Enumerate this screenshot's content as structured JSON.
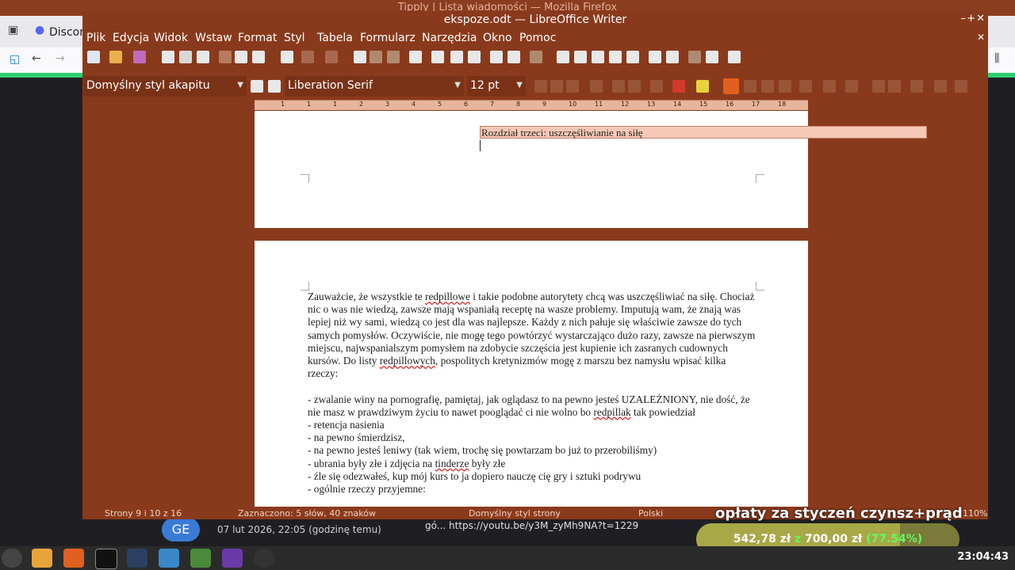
{
  "firefox": {
    "title": "Tipply | Lista wiadomości — Mozilla Firefox",
    "tab_label": "Discor",
    "tab_icon": "discord-icon"
  },
  "writer": {
    "title": "ekspoze.odt — LibreOffice Writer",
    "menu": [
      "Plik",
      "Edycja",
      "Widok",
      "Wstaw",
      "Format",
      "Styl",
      "Tabela",
      "Formularz",
      "Narzędzia",
      "Okno",
      "Pomoc"
    ],
    "paragraph_style": "Domyślny styl akapitu",
    "font_name": "Liberation Serif",
    "font_size": "12 pt",
    "ruler_labels": [
      "1",
      "1",
      "2",
      "3",
      "4",
      "5",
      "6",
      "7",
      "8",
      "9",
      "10",
      "11",
      "12",
      "13",
      "14",
      "15",
      "16",
      "17",
      "18"
    ],
    "heading": "Rozdział trzeci: uszczęśliwianie na siłę",
    "paragraphs": [
      [
        {
          "t": "Zauważcie, że wszystkie te "
        },
        {
          "t": "redpillowe",
          "s": 1
        },
        {
          "t": " i takie podobne autorytety chcą was uszczęśliwiać na siłę. Chociaż nic o was nie wiedzą, zawsze mają wspaniałą receptę na wasze problemy. Imputują wam, że znają was lepiej niż wy sami, wiedzą co jest dla was najlepsze. Każdy z nich pałuje się właściwie zawsze do tych samych pomysłów. Oczywiście, nie mogę tego powtórzyć wystarczająco dużo razy, zawsze na pierwszym miejscu, najwspanialszym pomysłem na zdobycie szczęścia jest kupienie ich zasranych cudownych kursów. Do listy "
        },
        {
          "t": "redpillowych",
          "s": 1
        },
        {
          "t": ", pospolitych kretynizmów mogę z marszu bez namysłu wpisać kilka rzeczy:"
        }
      ],
      [
        {
          "t": " "
        }
      ],
      [
        {
          "t": "- zwalanie winy na pornografię, pamiętaj, jak oglądasz to na pewno jesteś UZALEŻNIONY, nie dość, że nie masz w prawdziwym życiu to nawet pooglądać ci nie wolno bo "
        },
        {
          "t": "redpillak",
          "s": 1
        },
        {
          "t": " tak powiedział"
        }
      ],
      [
        {
          "t": "- retencja nasienia"
        }
      ],
      [
        {
          "t": "- na pewno śmierdzisz,"
        }
      ],
      [
        {
          "t": "- na pewno jesteś leniwy (tak wiem, trochę się powtarzam bo już to przerobiliśmy)"
        }
      ],
      [
        {
          "t": "- ubrania były złe i zdjęcia na "
        },
        {
          "t": "tinderze",
          "s": 1
        },
        {
          "t": " były złe"
        }
      ],
      [
        {
          "t": "- źle się odezwałeś, kup mój kurs to ja dopiero nauczę cię gry i sztuki podrywu"
        }
      ],
      [
        {
          "t": "- ogólnie rzeczy przyjemne:"
        }
      ]
    ],
    "status": {
      "pages": "Strony 9 i 10 z 16",
      "selection": "Zaznaczono: 5 słów, 40 znaków",
      "page_style": "Domyślny styl strony",
      "language": "Polski",
      "zoom": "110%"
    }
  },
  "background": {
    "avatar": "GE",
    "date": "07 lut 2026, 22:05 (godzinę temu)",
    "link": "gó... https://youtu.be/y3M_zyMh9NA?t=1229"
  },
  "overlay": {
    "title": "opłaty za styczeń czynsz+prąd",
    "amount": "542,78 zł",
    "sep": "z",
    "goal": "700,00 zł",
    "percent": "(77.54%)",
    "progress": 0.7754
  },
  "taskbar": {
    "clock": "23:04:43"
  },
  "colors": {
    "writer_bg": "#8a3a1c",
    "accent": "#e0601f",
    "progress_fill": "#a8a848"
  }
}
